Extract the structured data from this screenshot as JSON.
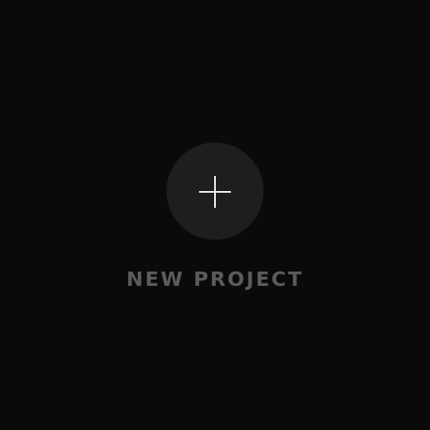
{
  "new_project": {
    "label": "NEW PROJECT",
    "icon": "plus-icon"
  },
  "colors": {
    "background": "#0a0a0a",
    "button_fill": "#1d1e20",
    "icon_stroke": "#ffffff",
    "label_text": "#5b5b5c"
  }
}
